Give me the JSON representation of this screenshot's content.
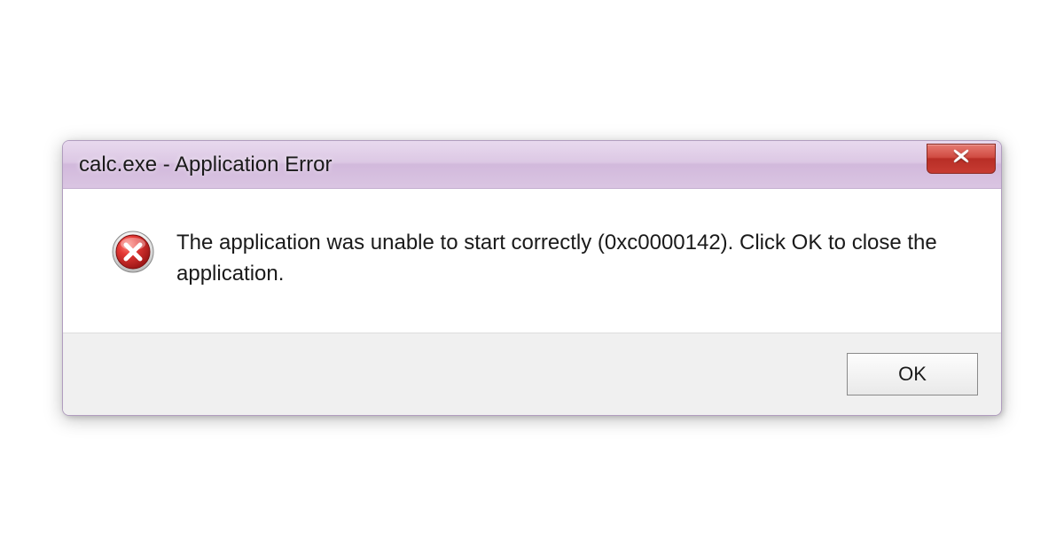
{
  "dialog": {
    "title": "calc.exe - Application Error",
    "message": "The application was unable to start correctly (0xc0000142). Click OK to close the application.",
    "ok_label": "OK"
  }
}
